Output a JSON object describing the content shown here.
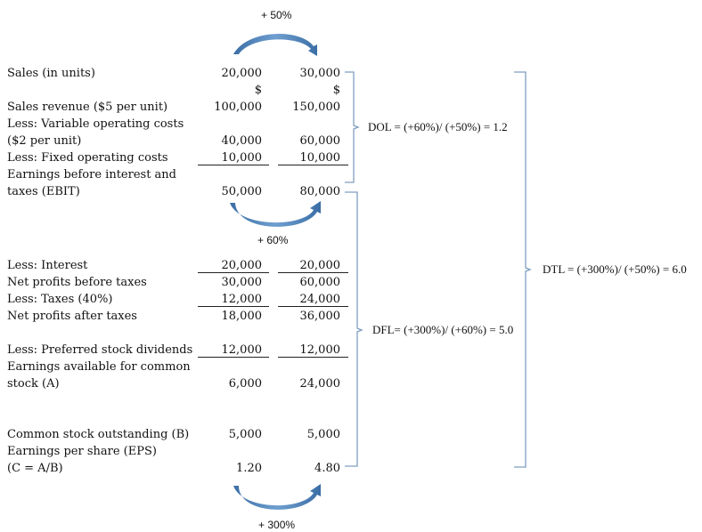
{
  "arrows": {
    "sales_change": "+ 50%",
    "ebit_change": "+ 60%",
    "eps_change": "+ 300%"
  },
  "rows": [
    {
      "label": "Sales (in units)",
      "v1": "20,000",
      "v2": "30,000"
    },
    {
      "label": "",
      "v1": "$",
      "v2": "$"
    },
    {
      "label": "Sales revenue ($5 per unit)",
      "v1": "100,000",
      "v2": "150,000"
    },
    {
      "label": "Less: Variable operating costs",
      "v1": "",
      "v2": ""
    },
    {
      "label": "($2 per unit)",
      "v1": "40,000",
      "v2": "60,000"
    },
    {
      "label": "Less: Fixed operating costs",
      "v1": "10,000",
      "v2": "10,000"
    },
    {
      "label": "Earnings before interest and",
      "v1": "",
      "v2": ""
    },
    {
      "label": "taxes (EBIT)",
      "v1": "50,000",
      "v2": "80,000"
    },
    {
      "label": "Less: Interest",
      "v1": "20,000",
      "v2": "20,000"
    },
    {
      "label": "Net profits before taxes",
      "v1": "30,000",
      "v2": "60,000"
    },
    {
      "label": "Less: Taxes (40%)",
      "v1": "12,000",
      "v2": "24,000"
    },
    {
      "label": "Net profits after taxes",
      "v1": "18,000",
      "v2": "36,000"
    },
    {
      "label": "Less: Preferred stock dividends",
      "v1": "12,000",
      "v2": "12,000"
    },
    {
      "label": "Earnings available for common",
      "v1": "",
      "v2": ""
    },
    {
      "label": "stock (A)",
      "v1": "6,000",
      "v2": "24,000"
    },
    {
      "label": "Common stock outstanding (B)",
      "v1": "5,000",
      "v2": "5,000"
    },
    {
      "label": "Earnings per share (EPS)",
      "v1": "",
      "v2": ""
    },
    {
      "label": "(C = A/B)",
      "v1": "1.20",
      "v2": "4.80"
    }
  ],
  "formulas": {
    "dol": "DOL = (+60%)/ (+50%) = 1.2",
    "dfl": "DFL= (+300%)/ (+60%) = 5.0",
    "dtl": "DTL = (+300%)/ (+50%) = 6.0"
  },
  "colors": {
    "arrow": "#4f81bd",
    "bracket": "#7f9fbf"
  }
}
